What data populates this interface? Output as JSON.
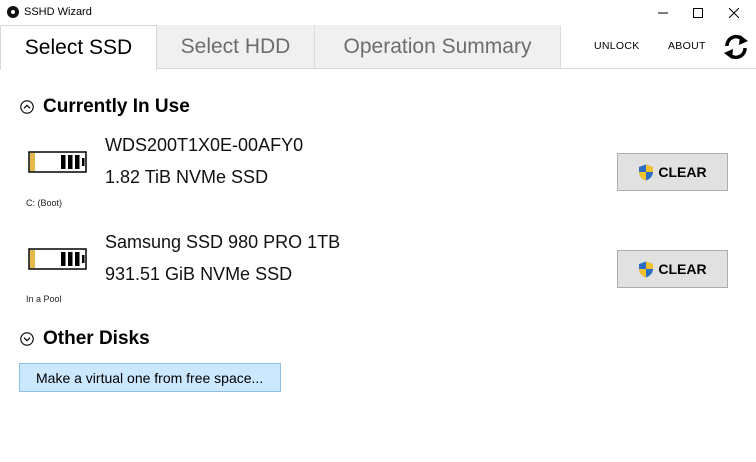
{
  "window": {
    "title": "SSHD Wizard"
  },
  "tabs": [
    {
      "label": "Select SSD",
      "active": true
    },
    {
      "label": "Select HDD",
      "active": false
    },
    {
      "label": "Operation Summary",
      "active": false
    }
  ],
  "toolbar": {
    "unlock_label": "UNLOCK",
    "about_label": "ABOUT",
    "refresh_icon": "refresh-icon"
  },
  "sections": {
    "in_use": {
      "title": "Currently In Use",
      "icon": "chevron-up-circle-icon"
    },
    "other": {
      "title": "Other Disks",
      "icon": "chevron-down-circle-icon"
    }
  },
  "disks": [
    {
      "name": "WDS200T1X0E-00AFY0",
      "detail": "1.82 TiB NVMe SSD",
      "status": "C: (Boot)",
      "action_label": "CLEAR"
    },
    {
      "name": "Samsung SSD 980 PRO 1TB",
      "detail": "931.51 GiB NVMe SSD",
      "status": "In a Pool",
      "action_label": "CLEAR"
    }
  ],
  "virtual_button": {
    "label": "Make a virtual one from free space..."
  },
  "colors": {
    "accent_button": "#cce8ff",
    "button_bg": "#e1e1e1",
    "tab_inactive": "#f0f0f0"
  }
}
